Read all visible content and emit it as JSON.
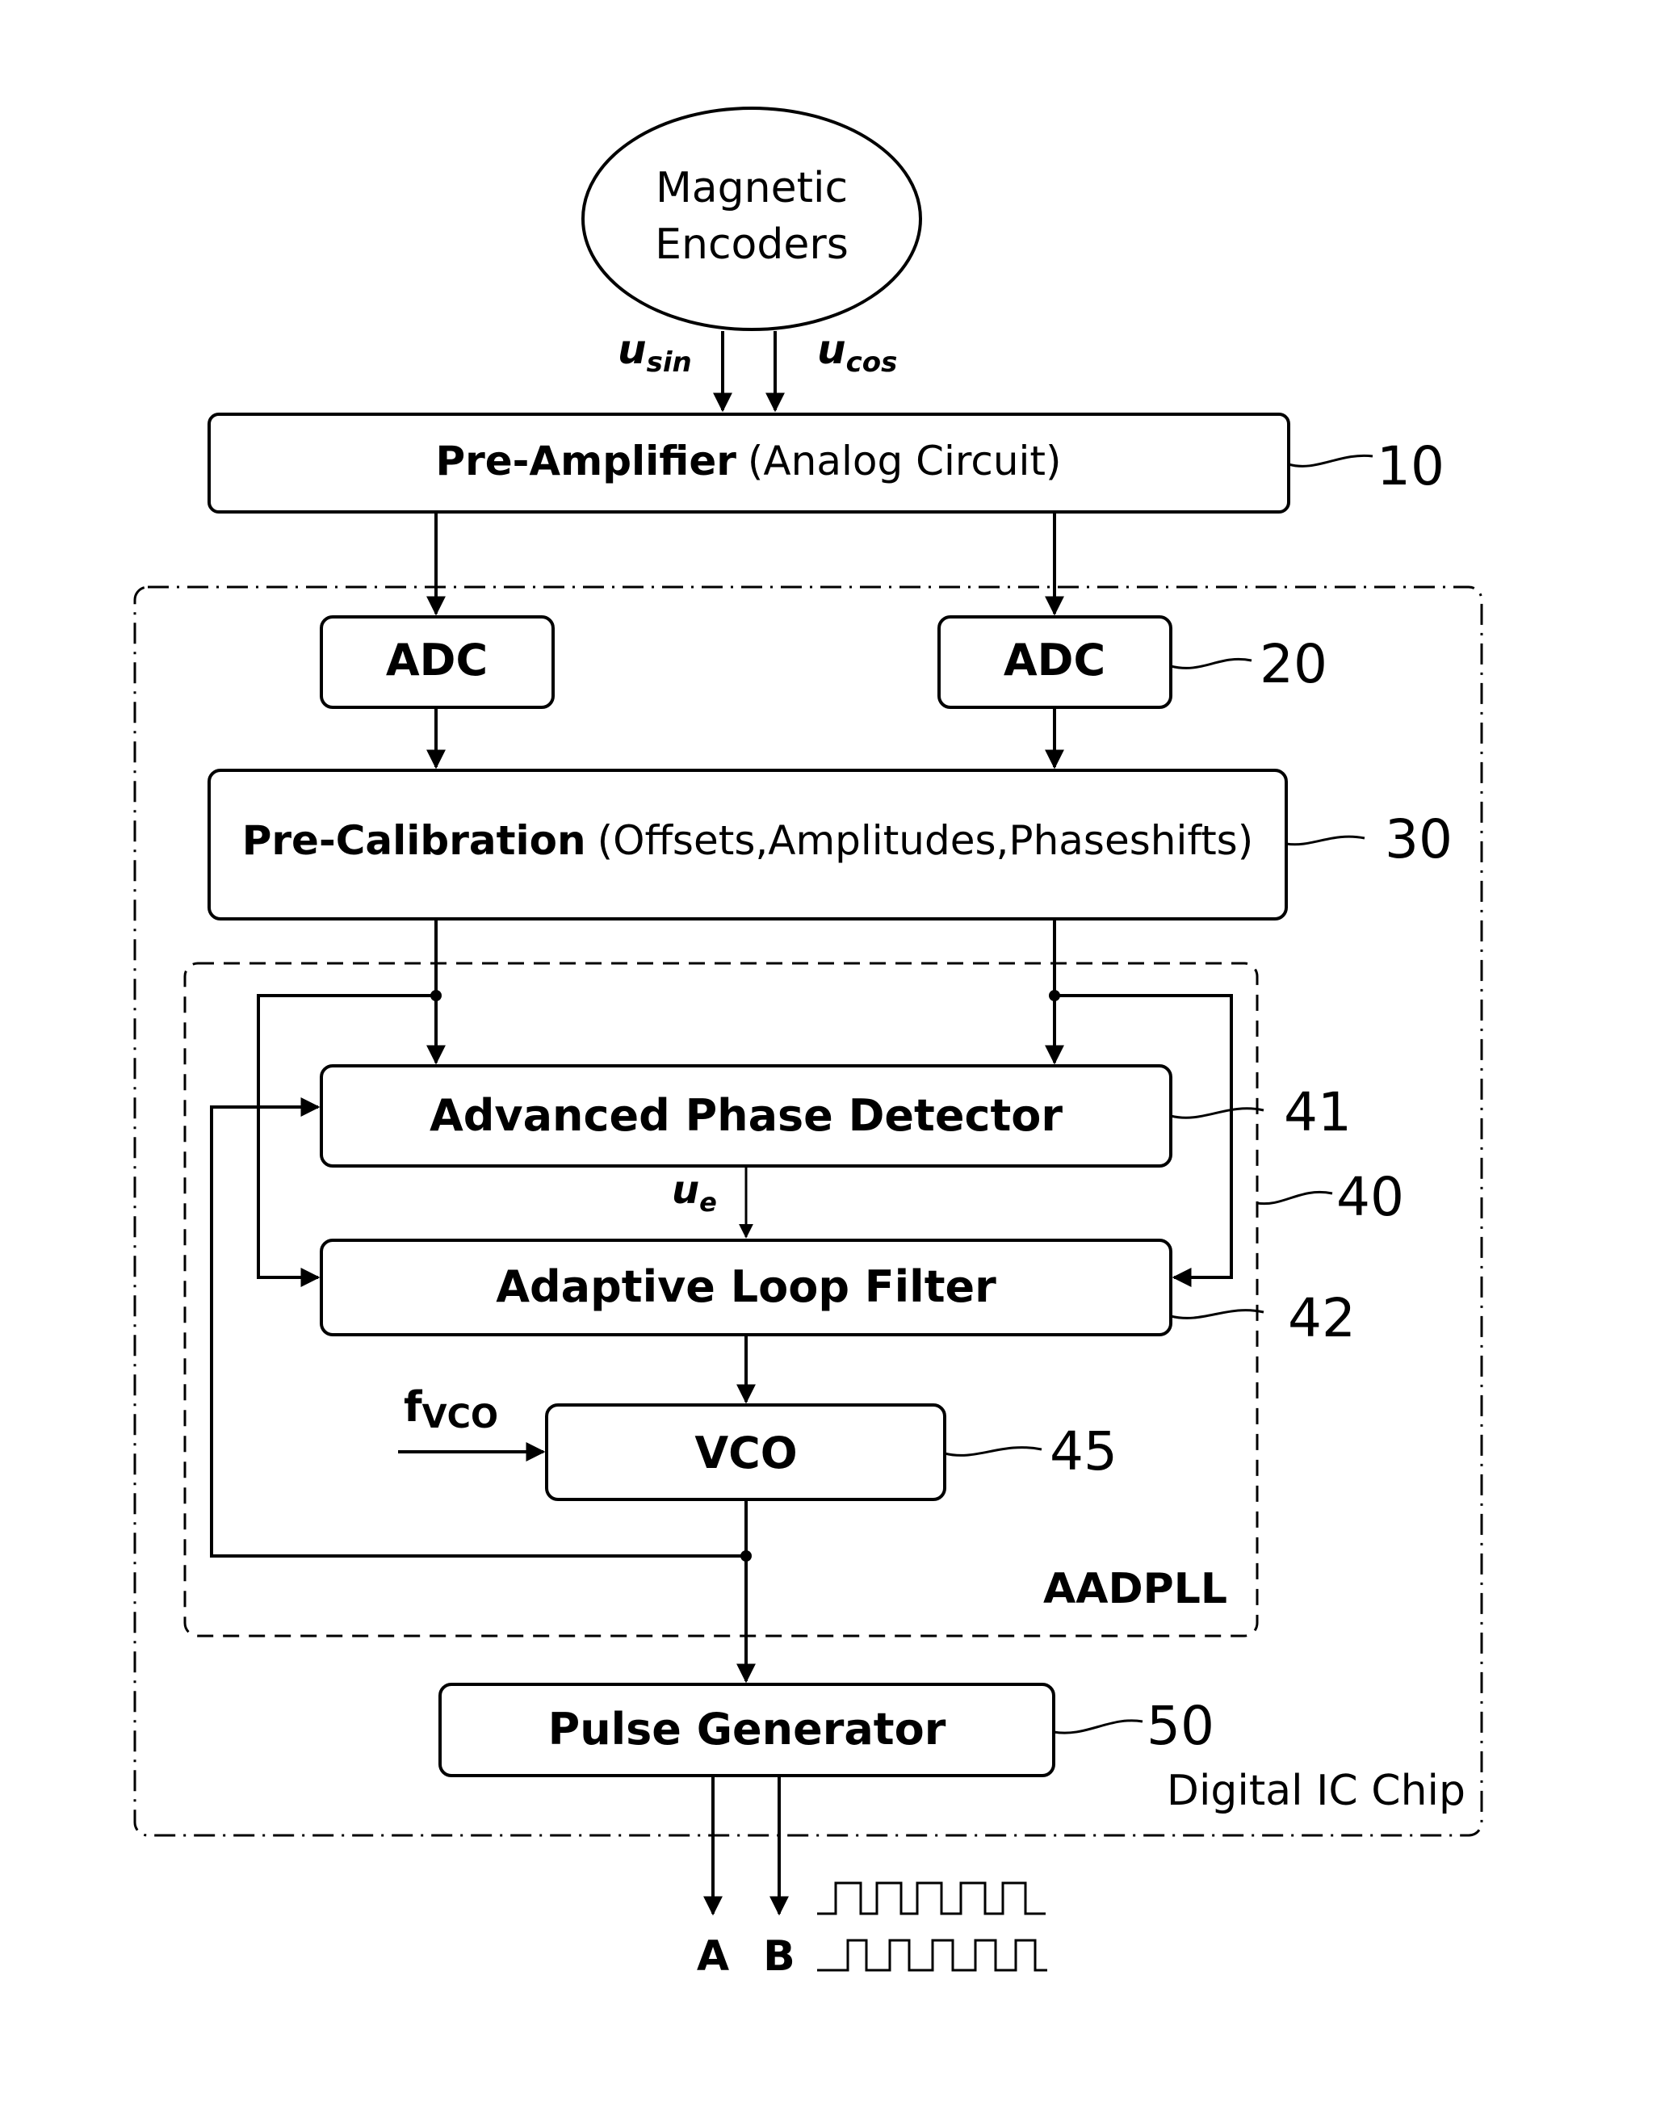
{
  "source": {
    "label_line1": "Magnetic",
    "label_line2": "Encoders",
    "signal_sin_base": "u",
    "signal_sin_sub": "sin",
    "signal_cos_base": "u",
    "signal_cos_sub": "cos"
  },
  "blocks": {
    "pre_amplifier": {
      "title": "Pre-Amplifier",
      "detail": "(Analog Circuit)",
      "ref": "10"
    },
    "adc_left": {
      "title": "ADC"
    },
    "adc_right": {
      "title": "ADC",
      "ref": "20"
    },
    "pre_calibration": {
      "title": "Pre-Calibration",
      "detail": "(Offsets,Amplitudes,Phaseshifts)",
      "ref": "30"
    },
    "phase_detector": {
      "title": "Advanced Phase Detector",
      "ref": "41"
    },
    "loop_filter": {
      "title": "Adaptive Loop Filter",
      "ref": "42"
    },
    "vco": {
      "title": "VCO",
      "ref": "45",
      "input_base": "f",
      "input_sub": "VCO"
    },
    "pulse_generator": {
      "title": "Pulse Generator",
      "ref": "50"
    }
  },
  "error_signal": {
    "base": "u",
    "sub": "e"
  },
  "groups": {
    "aadpll": {
      "label": "AADPLL",
      "ref": "40"
    },
    "chip": {
      "label": "Digital IC Chip"
    }
  },
  "outputs": {
    "a": "A",
    "b": "B"
  }
}
